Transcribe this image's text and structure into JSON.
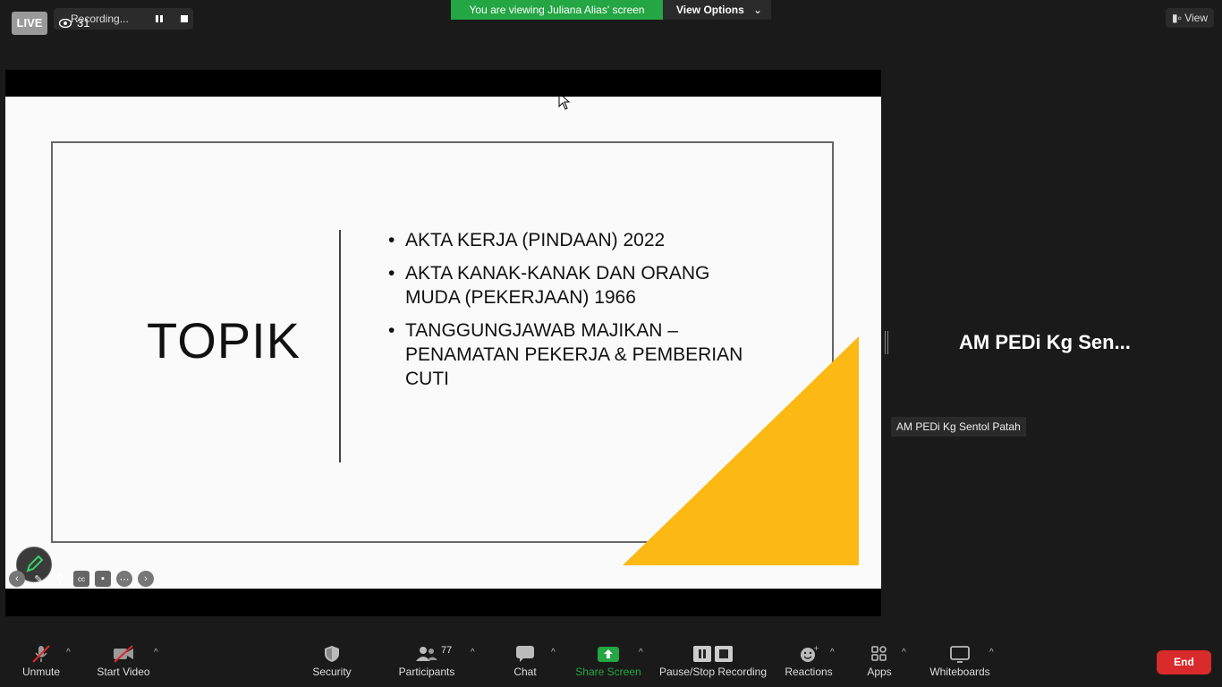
{
  "top_left": {
    "live_label": "LIVE",
    "viewer_count": "31",
    "recording_label": "Recording..."
  },
  "banner": {
    "viewing_text": "You are viewing Juliana Alias' screen",
    "view_options_label": "View Options"
  },
  "view_button_label": "View",
  "slide": {
    "title": "TOPIK",
    "bullets": [
      "AKTA KERJA (PINDAAN) 2022",
      "AKTA KANAK-KANAK DAN ORANG MUDA (PEKERJAAN) 1966",
      "TANGGUNGJAWAB MAJIKAN – PENAMATAN PEKERJA & PEMBERIAN CUTI"
    ],
    "accent_color": "#FDB913"
  },
  "participant": {
    "display_name_truncated": "AM PEDi Kg Sen...",
    "name_tag": "AM PEDi Kg Sentol Patah"
  },
  "toolbar": {
    "unmute": "Unmute",
    "start_video": "Start Video",
    "security": "Security",
    "participants": "Participants",
    "participants_count": "77",
    "chat": "Chat",
    "share_screen": "Share Screen",
    "pause_stop_recording": "Pause/Stop Recording",
    "reactions": "Reactions",
    "apps": "Apps",
    "whiteboards": "Whiteboards",
    "end": "End"
  },
  "colors": {
    "share_green": "#23A643",
    "end_red": "#D92B2B",
    "mute_red": "#E02828"
  }
}
